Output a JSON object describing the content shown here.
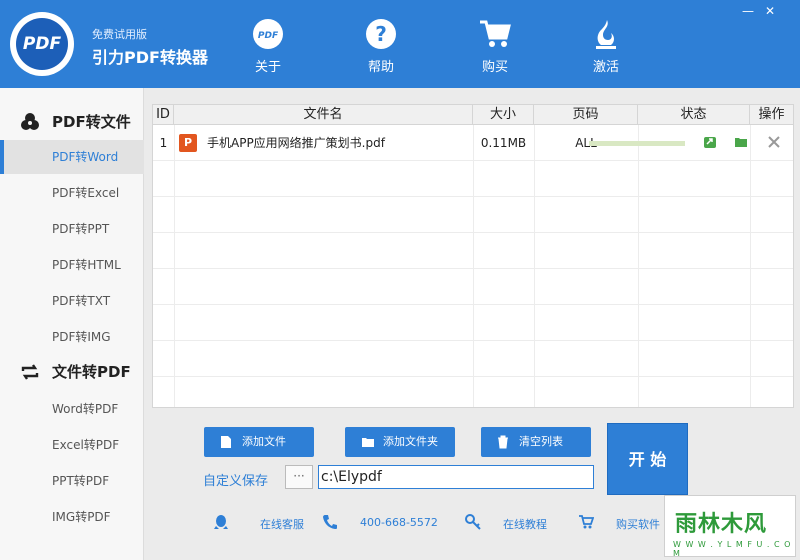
{
  "header": {
    "app_subtitle": "免费试用版",
    "app_title": "引力PDF转换器",
    "logo_text": "PDF",
    "nav": [
      {
        "label": "关于",
        "icon": "pdf-logo-icon"
      },
      {
        "label": "帮助",
        "icon": "question-icon"
      },
      {
        "label": "购买",
        "icon": "cart-icon"
      },
      {
        "label": "激活",
        "icon": "flame-icon"
      }
    ],
    "window_controls": {
      "minimize": "—",
      "close": "✕"
    }
  },
  "sidebar": {
    "group1": {
      "title": "PDF转文件",
      "icon": "convert-group-icon"
    },
    "group1_items": [
      "PDF转Word",
      "PDF转Excel",
      "PDF转PPT",
      "PDF转HTML",
      "PDF转TXT",
      "PDF转IMG"
    ],
    "group2": {
      "title": "文件转PDF",
      "icon": "refresh-icon"
    },
    "group2_items": [
      "Word转PDF",
      "Excel转PDF",
      "PPT转PDF",
      "IMG转PDF"
    ],
    "active_item": "PDF转Word"
  },
  "table": {
    "columns": [
      "ID",
      "文件名",
      "大小",
      "页码",
      "状态",
      "操作"
    ],
    "rows": [
      {
        "id": "1",
        "file_icon": "P",
        "filename": "手机APP应用网络推广策划书.pdf",
        "size": "0.11MB",
        "pages": "ALL",
        "progress": 0
      }
    ]
  },
  "actions": {
    "add_file": "添加文件",
    "add_folder": "添加文件夹",
    "clear_list": "清空列表",
    "start": "开 始"
  },
  "save": {
    "label": "自定义保存",
    "browse": "···",
    "path": "c:\\Elypdf"
  },
  "footer": {
    "online_service": "在线客服",
    "phone": "400-668-5572",
    "tutorial": "在线教程",
    "buy": "购买软件"
  },
  "watermark": {
    "main": "雨林木风",
    "sub": "W W W . Y L M F U . C O M"
  },
  "colors": {
    "primary": "#2e7fd6",
    "sidebar_bg": "#f7f7f7",
    "ppt_orange": "#e2561f",
    "watermark_green": "#2e9a3a"
  }
}
